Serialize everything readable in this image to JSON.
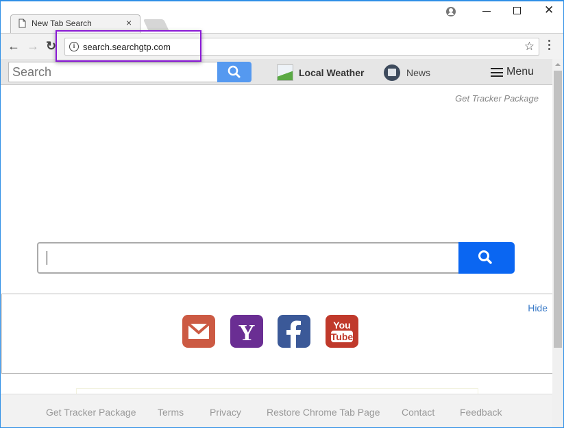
{
  "browser": {
    "tab_title": "New Tab Search",
    "url": "search.searchgtp.com",
    "icons": {
      "tab_favicon": "page-icon",
      "tab_close": "close-icon",
      "back": "arrow-left-icon",
      "forward": "arrow-right-icon",
      "reload": "reload-icon",
      "site_info": "info-icon",
      "bookmark": "star-icon",
      "menu": "kebab-icon",
      "profile": "profile-icon"
    },
    "glyphs": {
      "tab_close": "×",
      "back": "←",
      "forward": "→",
      "reload": "↻",
      "info": "i",
      "star": "☆",
      "close_window": "✕"
    },
    "highlight_color": "#8a19d6"
  },
  "topbar": {
    "search_placeholder": "Search",
    "search_button_color": "#5599f0",
    "weather_label": "Local Weather",
    "news_label": "News",
    "menu_label": "Menu"
  },
  "main": {
    "tracker_link": "Get Tracker Package",
    "search_value": "",
    "search_button_color": "#0a66f2"
  },
  "shortcuts": {
    "hide_label": "Hide",
    "items": [
      {
        "name": "Gmail",
        "color": "#cc5a43",
        "icon": "mail-icon"
      },
      {
        "name": "Yahoo",
        "color": "#6a2e93",
        "glyph": "Y",
        "icon": "yahoo-icon"
      },
      {
        "name": "Facebook",
        "color": "#3b5998",
        "glyph": "f",
        "icon": "facebook-icon"
      },
      {
        "name": "YouTube",
        "color": "#c0392b",
        "glyph_top": "You",
        "glyph_bottom": "Tube",
        "icon": "youtube-icon"
      }
    ]
  },
  "footer": {
    "links": [
      "Get Tracker Package",
      "Terms",
      "Privacy",
      "Restore Chrome Tab Page",
      "Contact",
      "Feedback"
    ]
  }
}
